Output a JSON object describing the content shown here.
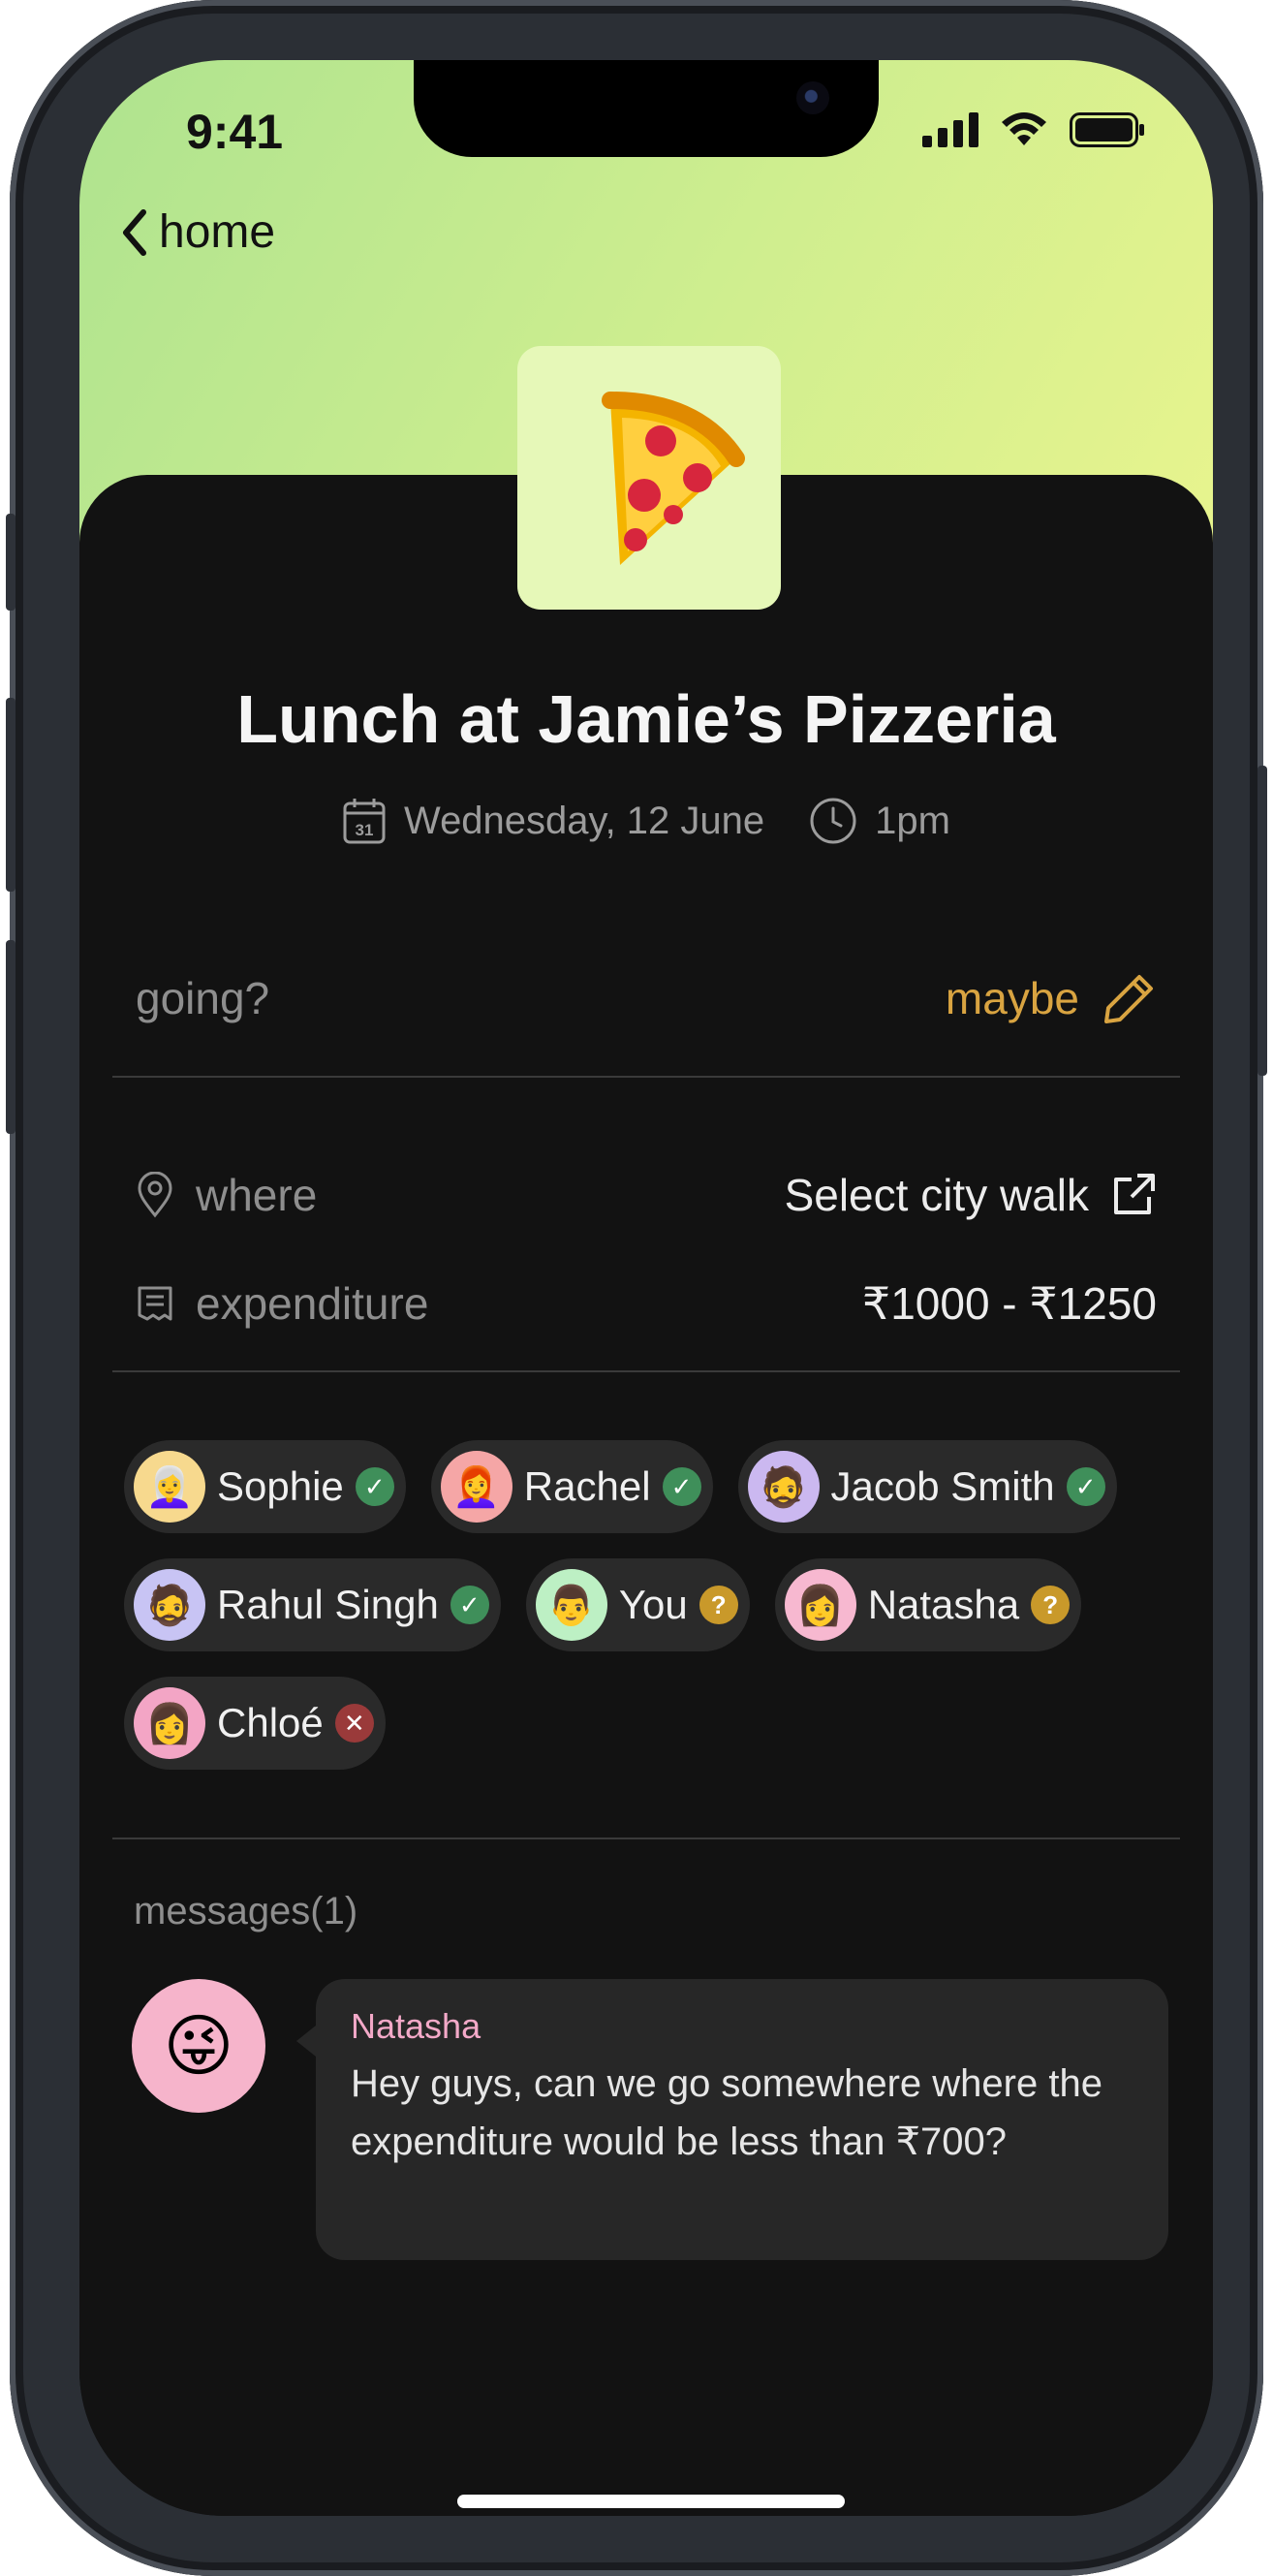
{
  "status_bar": {
    "time": "9:41"
  },
  "nav": {
    "back_label": "home"
  },
  "event": {
    "emoji": "🍕",
    "title": "Lunch at Jamie’s Pizzeria",
    "date": "Wednesday, 12 June",
    "calendar_day": "31",
    "time": "1pm"
  },
  "rsvp": {
    "label": "going?",
    "value": "maybe"
  },
  "details": {
    "where_label": "where",
    "where_value": "Select city walk",
    "expenditure_label": "expenditure",
    "expenditure_value": "₹1000 - ₹1250"
  },
  "attendees": [
    {
      "name": "Sophie",
      "status": "yes",
      "avatar_emoji": "👩‍🦳",
      "avatar_bg": "#f7d98e"
    },
    {
      "name": "Rachel",
      "status": "yes",
      "avatar_emoji": "👩‍🦰",
      "avatar_bg": "#f5a6a6"
    },
    {
      "name": "Jacob Smith",
      "status": "yes",
      "avatar_emoji": "🧔",
      "avatar_bg": "#cbb8f0"
    },
    {
      "name": "Rahul Singh",
      "status": "yes",
      "avatar_emoji": "🧔",
      "avatar_bg": "#c8c4f4"
    },
    {
      "name": "You",
      "status": "maybe",
      "avatar_emoji": "👨",
      "avatar_bg": "#bdf0c4"
    },
    {
      "name": "Natasha",
      "status": "maybe",
      "avatar_emoji": "👩",
      "avatar_bg": "#f7b8d0"
    },
    {
      "name": "Chloé",
      "status": "no",
      "avatar_emoji": "👩",
      "avatar_bg": "#f3a5c5"
    }
  ],
  "status_colors": {
    "yes": "#3f8f5a",
    "maybe": "#c9992a",
    "no": "#9a3a3a"
  },
  "status_glyphs": {
    "yes": "✓",
    "maybe": "?",
    "no": "✕"
  },
  "messages": {
    "title": "messages(1)",
    "items": [
      {
        "author": "Natasha",
        "avatar_emoji": "😜",
        "text": "Hey guys, can we go somewhere where the expenditure would be less than ₹700?"
      }
    ]
  },
  "colors": {
    "accent": "#d9a441",
    "background": "#121212",
    "header_gradient_start": "#aee38f",
    "header_gradient_end": "#e8f48e"
  }
}
